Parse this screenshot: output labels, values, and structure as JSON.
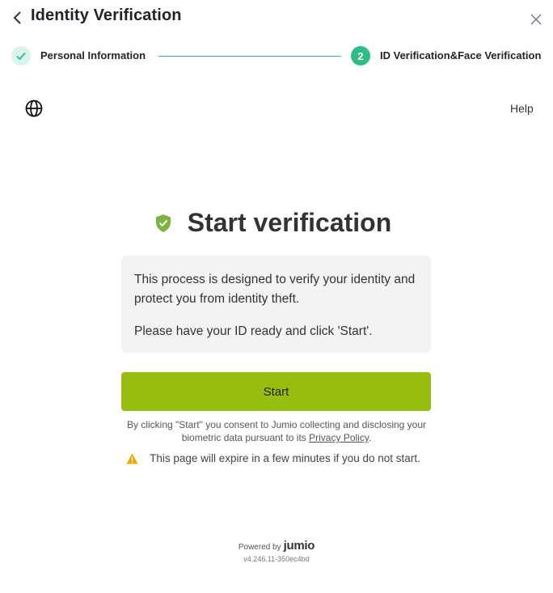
{
  "header": {
    "title": "Identity Verification"
  },
  "stepper": {
    "step1": {
      "label": "Personal Information",
      "status": "completed"
    },
    "step2": {
      "number": "2",
      "label": "ID Verification&Face Verification",
      "status": "active"
    },
    "accent_color": "#2ebd85"
  },
  "panel": {
    "help_label": "Help",
    "heading": "Start verification",
    "info_line1": "This process is designed to verify your identity and protect you from identity theft.",
    "info_line2": "Please have your ID ready and click 'Start'.",
    "start_label": "Start",
    "start_color": "#96bd10",
    "consent_text": "By clicking \"Start\" you consent to Jumio collecting and disclosing your biometric data pursuant to its ",
    "privacy_link": "Privacy Policy",
    "consent_end": ".",
    "expire_text": "This page will expire in a few minutes if you do not start."
  },
  "footer": {
    "powered_by": "Powered by",
    "brand": "jumio",
    "version": "v4.246.11-350ec4bd"
  },
  "icons": {
    "back": "chevron-left-icon",
    "close": "close-icon",
    "check": "check-icon",
    "globe": "globe-icon",
    "shield": "shield-check-icon",
    "warning": "warning-icon"
  }
}
